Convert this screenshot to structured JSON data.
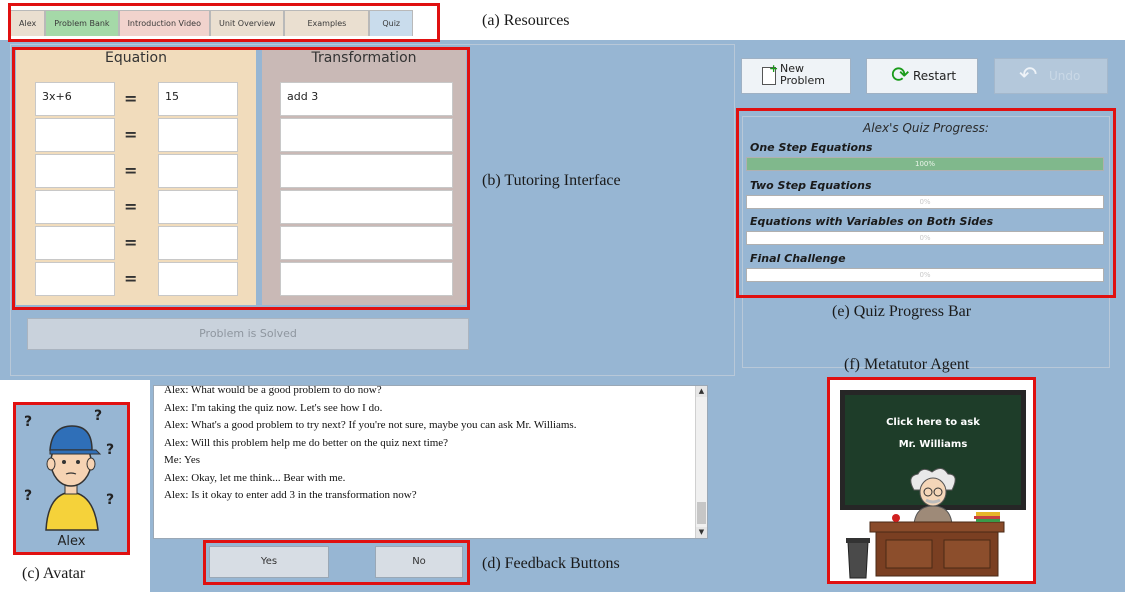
{
  "tabs": [
    "Alex",
    "Problem Bank",
    "Introduction Video",
    "Unit Overview",
    "Examples",
    "Quiz"
  ],
  "annotations": {
    "resources": "(a) Resources",
    "tutoring": "(b) Tutoring Interface",
    "avatar": "(c) Avatar",
    "feedback": "(d) Feedback Buttons",
    "quiz_bar": "(e) Quiz Progress Bar",
    "agent": "(f) Metatutor Agent"
  },
  "tutor": {
    "equation_title": "Equation",
    "transformation_title": "Transformation",
    "rows": [
      {
        "left": "3x+6",
        "right": "15",
        "transformation": "add 3"
      },
      {
        "left": "",
        "right": "",
        "transformation": ""
      },
      {
        "left": "",
        "right": "",
        "transformation": ""
      },
      {
        "left": "",
        "right": "",
        "transformation": ""
      },
      {
        "left": "",
        "right": "",
        "transformation": ""
      },
      {
        "left": "",
        "right": "",
        "transformation": ""
      }
    ],
    "equals": "=",
    "solved_label": "Problem is Solved"
  },
  "controls": {
    "new_problem": "New Problem",
    "restart": "Restart",
    "undo": "Undo"
  },
  "quiz": {
    "title": "Alex's Quiz Progress:",
    "items": [
      {
        "label": "One Step Equations",
        "progress": 100,
        "text": "100%"
      },
      {
        "label": "Two Step Equations",
        "progress": 0,
        "text": "0%"
      },
      {
        "label": "Equations with Variables on Both Sides",
        "progress": 0,
        "text": "0%"
      },
      {
        "label": "Final Challenge",
        "progress": 0,
        "text": "0%"
      }
    ]
  },
  "chat": {
    "lines": [
      "Alex: What would be a good problem to do now?",
      "Alex: I'm taking the quiz now.  Let's see how I do.",
      "Alex: What's a good problem to try next? If you're not sure, maybe you can ask Mr. Williams.",
      "Alex: Will this problem help me do better on the quiz next time?",
      "Me: Yes",
      "Alex: Okay, let me think... Bear with me.",
      "Alex: Is it okay to enter add 3 in the transformation now?"
    ]
  },
  "feedback": {
    "yes": "Yes",
    "no": "No"
  },
  "avatar": {
    "name": "Alex",
    "marks": "?"
  },
  "agent": {
    "line1": "Click here to ask",
    "line2": "Mr. Williams"
  },
  "colors": {
    "panel_blue": "#97b6d3",
    "annotation_red": "#e01010",
    "progress_green": "#80b88c",
    "equation_panel": "#f1dcbc",
    "transformation_panel": "#c9b9b6"
  }
}
